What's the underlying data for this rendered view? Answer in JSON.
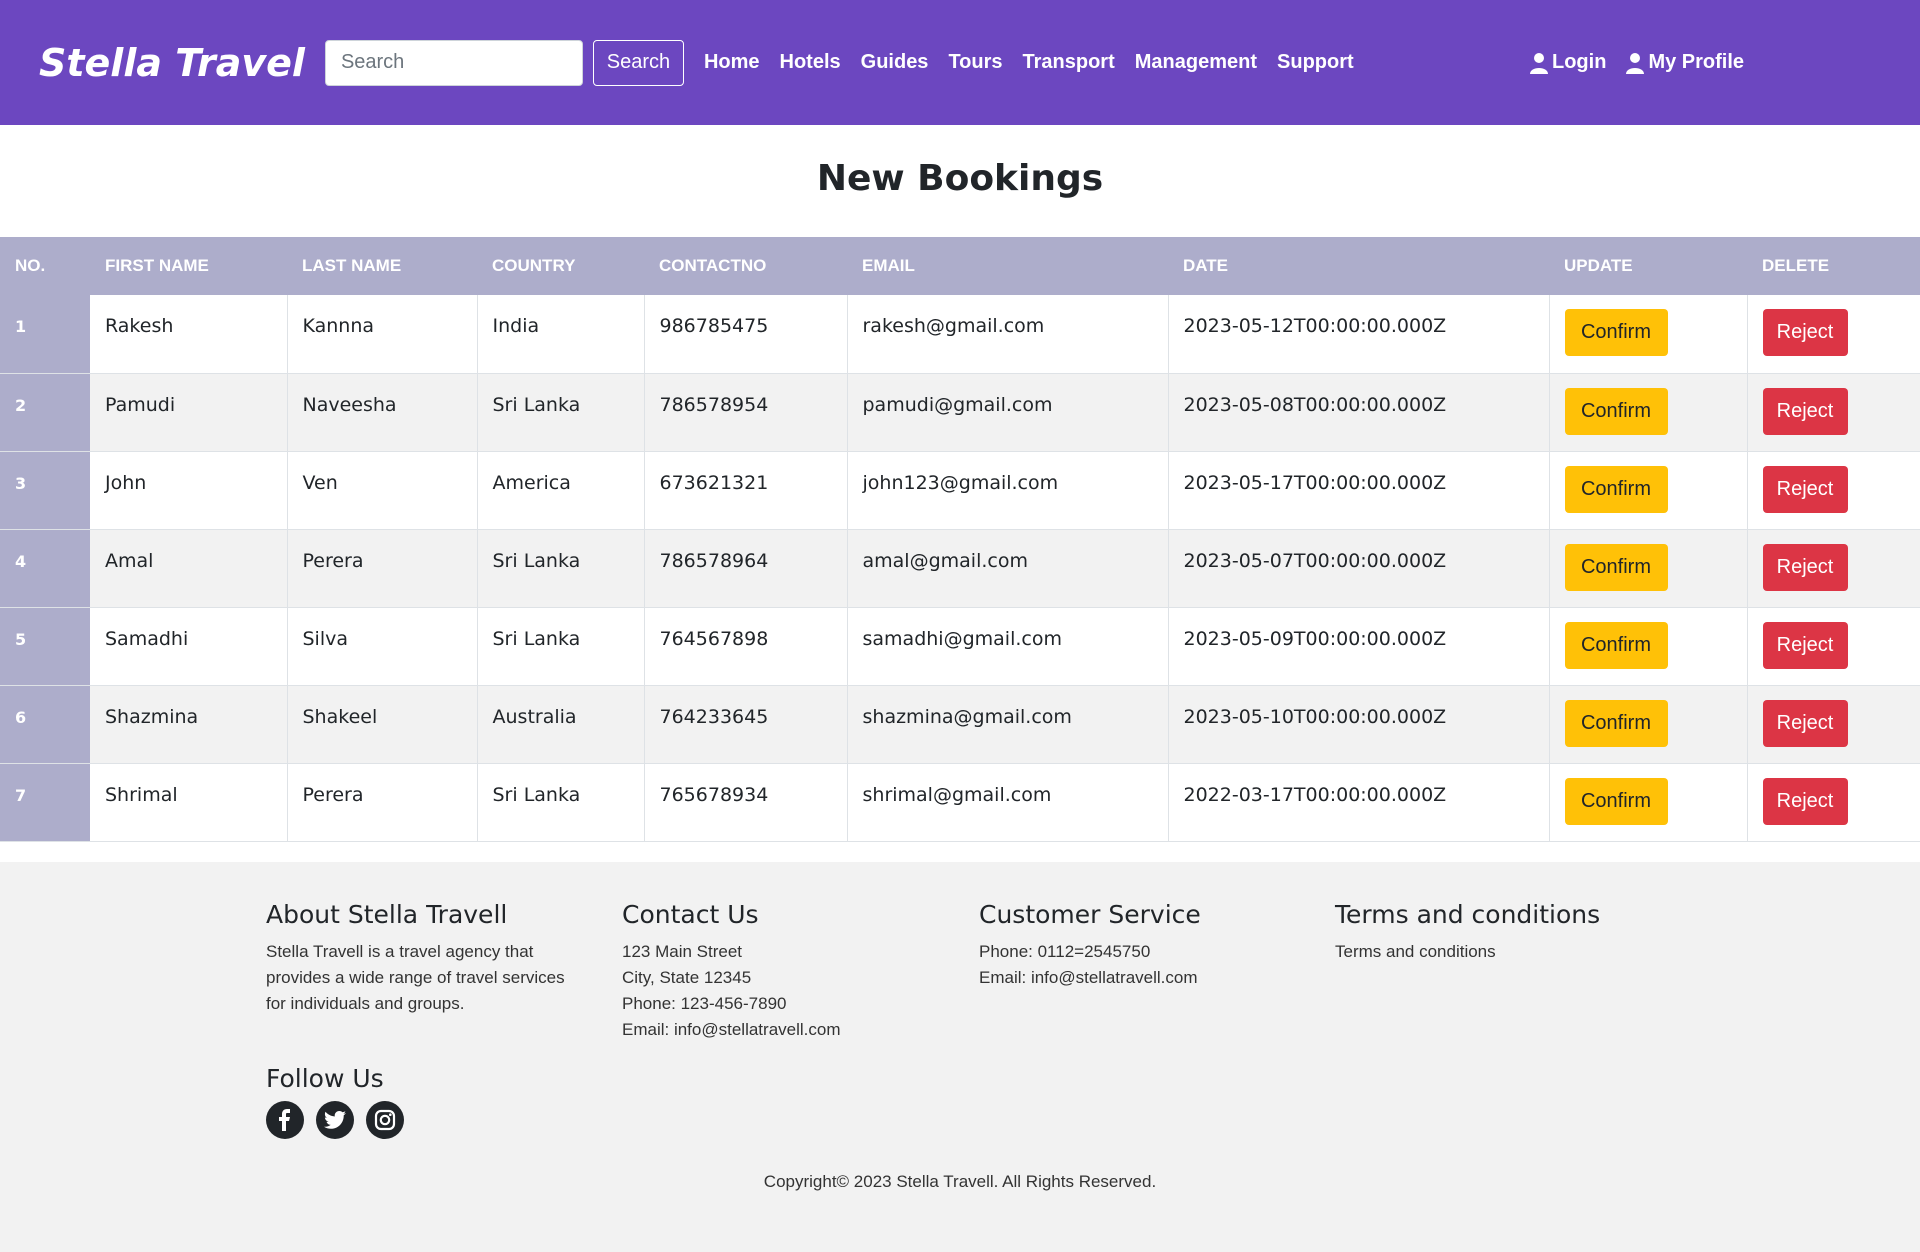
{
  "navbar": {
    "brand": "Stella Travel",
    "search_placeholder": "Search",
    "search_button": "Search",
    "links": [
      "Home",
      "Hotels",
      "Guides",
      "Tours",
      "Transport",
      "Management",
      "Support"
    ],
    "login": "Login",
    "profile": "My Profile"
  },
  "page": {
    "title": "New Bookings"
  },
  "table": {
    "headers": [
      "NO.",
      "FIRST NAME",
      "LAST NAME",
      "COUNTRY",
      "CONTACTNO",
      "EMAIL",
      "DATE",
      "UPDATE",
      "DELETE"
    ],
    "confirm_label": "Confirm",
    "reject_label": "Reject",
    "rows": [
      {
        "no": "1",
        "first": "Rakesh",
        "last": "Kannna",
        "country": "India",
        "contact": "986785475",
        "email": "rakesh@gmail.com",
        "date": "2023-05-12T00:00:00.000Z"
      },
      {
        "no": "2",
        "first": "Pamudi",
        "last": "Naveesha",
        "country": "Sri Lanka",
        "contact": "786578954",
        "email": "pamudi@gmail.com",
        "date": "2023-05-08T00:00:00.000Z"
      },
      {
        "no": "3",
        "first": "John",
        "last": "Ven",
        "country": "America",
        "contact": "673621321",
        "email": "john123@gmail.com",
        "date": "2023-05-17T00:00:00.000Z"
      },
      {
        "no": "4",
        "first": "Amal",
        "last": "Perera",
        "country": "Sri Lanka",
        "contact": "786578964",
        "email": "amal@gmail.com",
        "date": "2023-05-07T00:00:00.000Z"
      },
      {
        "no": "5",
        "first": "Samadhi",
        "last": "Silva",
        "country": "Sri Lanka",
        "contact": "764567898",
        "email": "samadhi@gmail.com",
        "date": "2023-05-09T00:00:00.000Z"
      },
      {
        "no": "6",
        "first": "Shazmina",
        "last": "Shakeel",
        "country": "Australia",
        "contact": "764233645",
        "email": "shazmina@gmail.com",
        "date": "2023-05-10T00:00:00.000Z"
      },
      {
        "no": "7",
        "first": "Shrimal",
        "last": "Perera",
        "country": "Sri Lanka",
        "contact": "765678934",
        "email": "shrimal@gmail.com",
        "date": "2022-03-17T00:00:00.000Z"
      }
    ]
  },
  "footer": {
    "about": {
      "title": "About Stella Travell",
      "text": "Stella Travell is a travel agency that provides a wide range of travel services for individuals and groups."
    },
    "contact": {
      "title": "Contact Us",
      "address": "123 Main Street",
      "city": "City, State 12345",
      "phone": "Phone: 123-456-7890",
      "email": "Email: info@stellatravell.com"
    },
    "service": {
      "title": "Customer Service",
      "phone": "Phone: 0112=2545750",
      "email": "Email: info@stellatravell.com"
    },
    "terms": {
      "title": "Terms and conditions",
      "link": "Terms and conditions"
    },
    "follow": {
      "title": "Follow Us",
      "icons": [
        "facebook-icon",
        "twitter-icon",
        "instagram-icon"
      ]
    },
    "copyright": "Copyright© 2023 Stella Travell. All Rights Reserved."
  },
  "colors": {
    "navbar": "#6c47c0",
    "table_header": "#adadcb",
    "confirm": "#ffc107",
    "reject": "#dc3545",
    "footer": "#f2f2f2"
  }
}
